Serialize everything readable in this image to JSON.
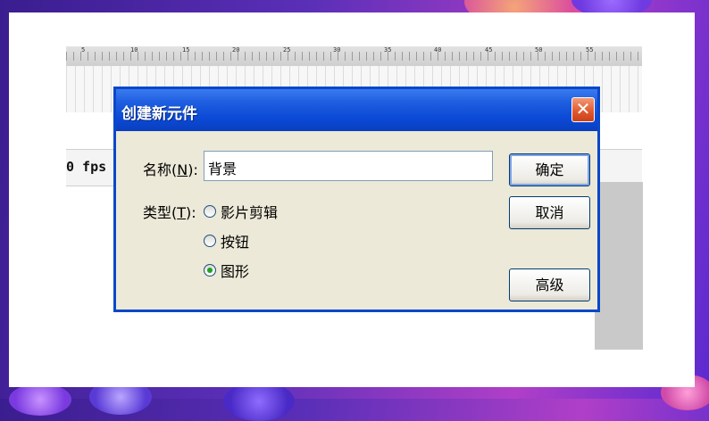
{
  "timeline": {
    "tick_labels": [
      "5",
      "10",
      "15",
      "20",
      "25",
      "30",
      "35",
      "40",
      "45",
      "50",
      "55"
    ],
    "fps_text": "0 fps"
  },
  "dialog": {
    "title": "创建新元件",
    "close_glyph": "✕",
    "name_label_prefix": "名称(",
    "name_label_key": "N",
    "name_label_suffix": "):",
    "name_value": "背景",
    "type_label_prefix": "类型(",
    "type_label_key": "T",
    "type_label_suffix": "):",
    "type_options": [
      {
        "label": "影片剪辑",
        "checked": false
      },
      {
        "label": "按钮",
        "checked": false
      },
      {
        "label": "图形",
        "checked": true
      }
    ],
    "buttons": {
      "ok": "确定",
      "cancel": "取消",
      "advanced": "高级"
    }
  }
}
